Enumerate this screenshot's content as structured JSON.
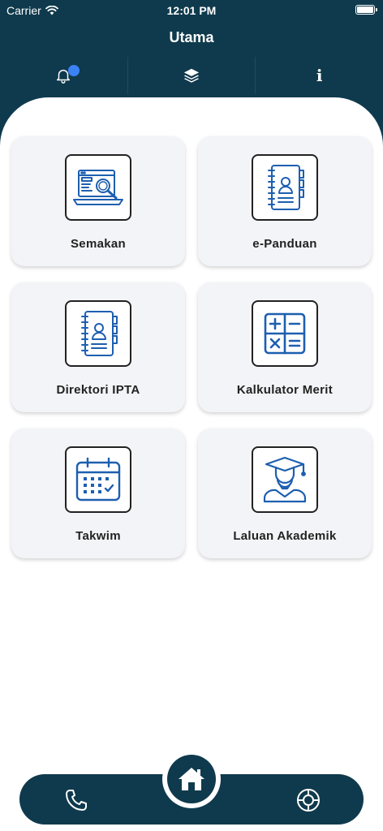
{
  "status_bar": {
    "carrier": "Carrier",
    "time": "12:01 PM"
  },
  "header": {
    "title": "Utama"
  },
  "top_tabs": [
    {
      "icon": "bell-icon",
      "has_badge": true
    },
    {
      "icon": "layers-icon"
    },
    {
      "icon": "info-icon",
      "glyph": "i"
    }
  ],
  "menu": [
    {
      "id": "semakan",
      "label": "Semakan",
      "icon": "search-screen-icon"
    },
    {
      "id": "e-panduan",
      "label": "e-Panduan",
      "icon": "notebook-icon"
    },
    {
      "id": "direktori-ipta",
      "label": "Direktori IPTA",
      "icon": "address-book-icon"
    },
    {
      "id": "kalkulator-merit",
      "label": "Kalkulator Merit",
      "icon": "calculator-icon"
    },
    {
      "id": "takwim",
      "label": "Takwim",
      "icon": "calendar-icon"
    },
    {
      "id": "laluan-akademik",
      "label": "Laluan Akademik",
      "icon": "graduate-icon"
    }
  ],
  "bottom_nav": [
    {
      "icon": "phone-icon"
    },
    {
      "icon": "home-icon"
    },
    {
      "icon": "lifebuoy-icon"
    }
  ],
  "colors": {
    "primary": "#0f3a4d",
    "accent_blue": "#1d5fb0",
    "badge": "#3b82f6",
    "card_bg": "#f3f4f8"
  }
}
